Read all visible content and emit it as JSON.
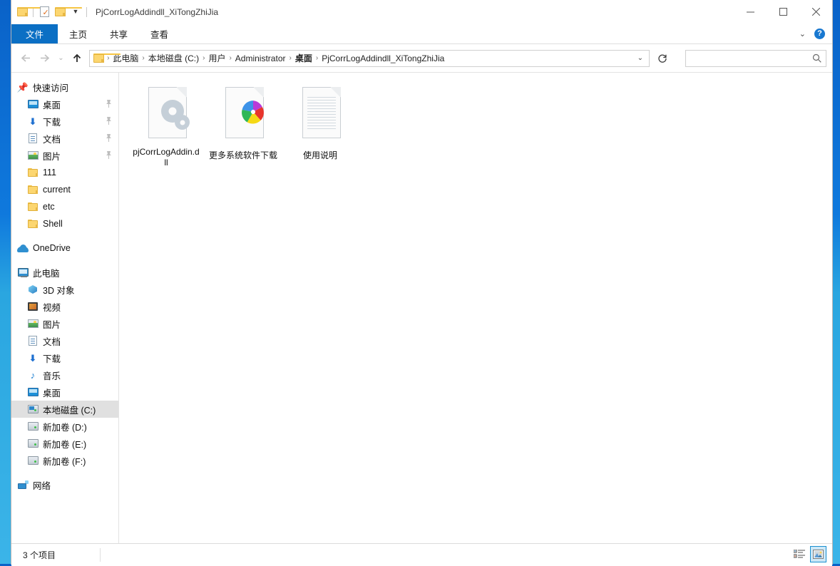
{
  "window": {
    "title": "PjCorrLogAddindll_XiTongZhiJia",
    "quick_access": [
      {
        "name": "folder-icon",
        "label": ""
      },
      {
        "name": "properties-icon",
        "label": ""
      },
      {
        "name": "new-folder-icon",
        "label": ""
      },
      {
        "name": "chevron-down-icon",
        "label": "▾"
      }
    ],
    "controls": {
      "minimize": "minimize-icon",
      "maximize": "maximize-icon",
      "close": "close-icon"
    }
  },
  "ribbon": {
    "tabs": [
      {
        "label": "文件",
        "active": true
      },
      {
        "label": "主页",
        "active": false
      },
      {
        "label": "共享",
        "active": false
      },
      {
        "label": "查看",
        "active": false
      }
    ],
    "expand_label": "⌄",
    "help_label": "?"
  },
  "address": {
    "back_label": "←",
    "forward_label": "→",
    "recent_label": "⌄",
    "up_label": "↑",
    "crumbs": [
      {
        "label": "此电脑",
        "bold": false
      },
      {
        "label": "本地磁盘 (C:)",
        "bold": false
      },
      {
        "label": "用户",
        "bold": false
      },
      {
        "label": "Administrator",
        "bold": false
      },
      {
        "label": "桌面",
        "bold": true
      },
      {
        "label": "PjCorrLogAddindll_XiTongZhiJia",
        "bold": false
      }
    ],
    "separator": "›",
    "dropdown_label": "⌄",
    "refresh_label": "↻"
  },
  "search": {
    "value": "",
    "placeholder": "",
    "icon": "search-icon"
  },
  "sidebar": {
    "groups": [
      {
        "header": {
          "label": "快速访问",
          "icon": "star-pin-icon"
        },
        "items": [
          {
            "label": "桌面",
            "icon": "desktop-icon",
            "pinned": true,
            "selected": false
          },
          {
            "label": "下载",
            "icon": "downloads-icon",
            "pinned": true,
            "selected": false
          },
          {
            "label": "文档",
            "icon": "documents-icon",
            "pinned": true,
            "selected": false
          },
          {
            "label": "图片",
            "icon": "pictures-icon",
            "pinned": true,
            "selected": false
          },
          {
            "label": "111",
            "icon": "folder-icon",
            "pinned": false,
            "selected": false
          },
          {
            "label": "current",
            "icon": "folder-icon",
            "pinned": false,
            "selected": false
          },
          {
            "label": "etc",
            "icon": "folder-icon",
            "pinned": false,
            "selected": false
          },
          {
            "label": "Shell",
            "icon": "folder-icon",
            "pinned": false,
            "selected": false
          }
        ]
      },
      {
        "header": {
          "label": "OneDrive",
          "icon": "cloud-icon"
        },
        "items": []
      },
      {
        "header": {
          "label": "此电脑",
          "icon": "this-pc-icon"
        },
        "items": [
          {
            "label": "3D 对象",
            "icon": "cube-icon",
            "pinned": false,
            "selected": false
          },
          {
            "label": "视频",
            "icon": "videos-icon",
            "pinned": false,
            "selected": false
          },
          {
            "label": "图片",
            "icon": "pictures-icon",
            "pinned": false,
            "selected": false
          },
          {
            "label": "文档",
            "icon": "documents-icon",
            "pinned": false,
            "selected": false
          },
          {
            "label": "下载",
            "icon": "downloads-icon",
            "pinned": false,
            "selected": false
          },
          {
            "label": "音乐",
            "icon": "music-icon",
            "pinned": false,
            "selected": false
          },
          {
            "label": "桌面",
            "icon": "desktop-icon",
            "pinned": false,
            "selected": false
          },
          {
            "label": "本地磁盘 (C:)",
            "icon": "drive-windows-icon",
            "pinned": false,
            "selected": true
          },
          {
            "label": "新加卷 (D:)",
            "icon": "drive-icon",
            "pinned": false,
            "selected": false
          },
          {
            "label": "新加卷 (E:)",
            "icon": "drive-icon",
            "pinned": false,
            "selected": false
          },
          {
            "label": "新加卷 (F:)",
            "icon": "drive-icon",
            "pinned": false,
            "selected": false
          }
        ]
      },
      {
        "header": {
          "label": "网络",
          "icon": "network-icon"
        },
        "items": []
      }
    ]
  },
  "files": [
    {
      "name": "pjCorrLogAddin.dll",
      "icon": "dll-gears-icon"
    },
    {
      "name": "更多系统软件下载",
      "icon": "pinwheel-shortcut-icon"
    },
    {
      "name": "使用说明",
      "icon": "text-document-icon"
    }
  ],
  "statusbar": {
    "item_count": "3 个项目",
    "views": [
      {
        "name": "details-view-button",
        "active": false
      },
      {
        "name": "large-icons-view-button",
        "active": true
      }
    ]
  },
  "colors": {
    "accent": "#0b6fc4",
    "folder": "#fcd670",
    "selection": "#e0e0e0",
    "desktop_top": "#0a62c8",
    "desktop_bottom": "#3bb4e8"
  }
}
